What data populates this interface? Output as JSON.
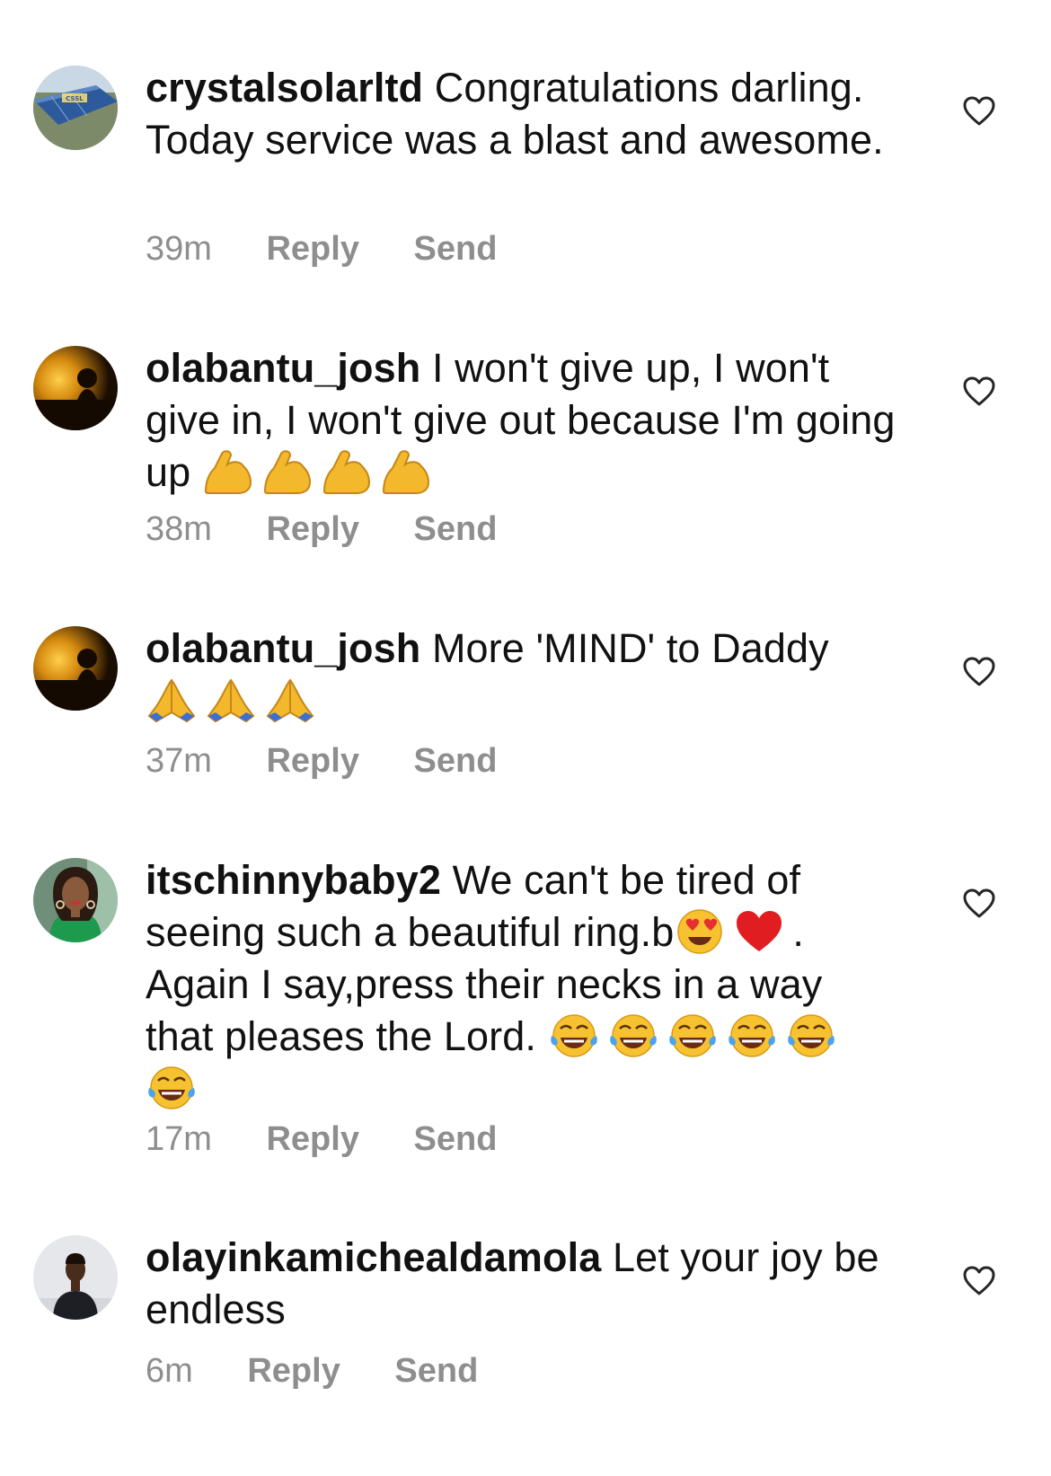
{
  "comments": [
    {
      "username": "crystalsolarltd",
      "text": "Congratulations darling. Today service was a blast and awesome.",
      "emojis": "",
      "time": "39m",
      "reply_label": "Reply",
      "send_label": "Send",
      "avatar_text": "CSSL"
    },
    {
      "username": "olabantu_josh",
      "text": "I won't give up, I won't give in, I won't give out because I'm going up",
      "emojis": "💪💪💪💪",
      "time": "38m",
      "reply_label": "Reply",
      "send_label": "Send"
    },
    {
      "username": "olabantu_josh",
      "text": "More 'MIND' to Daddy",
      "emojis": "🙏🙏🙏",
      "time": "37m",
      "reply_label": "Reply",
      "send_label": "Send"
    },
    {
      "username": "itschinnybaby2",
      "text_part1": "We can't be tired of seeing such a beautiful ring.b",
      "emojis_inline": "😍❤️",
      "text_part2": ". Again I say,press their necks in a way that pleases the Lord.",
      "emojis": "😂😂😂😂😂😂",
      "time": "17m",
      "reply_label": "Reply",
      "send_label": "Send"
    },
    {
      "username": "olayinkamichealdamola",
      "text": "Let your joy be endless",
      "emojis": "",
      "time": "6m",
      "reply_label": "Reply",
      "send_label": "Send"
    }
  ],
  "colors": {
    "text": "#111111",
    "meta": "#8e8e8e",
    "like_outline": "#262626"
  },
  "icons": {
    "like": "heart-outline-icon",
    "flex": "flexed-biceps-emoji",
    "pray": "folded-hands-emoji",
    "heart_eyes": "heart-eyes-emoji",
    "red_heart": "red-heart-emoji",
    "tears_of_joy": "tears-of-joy-emoji"
  }
}
